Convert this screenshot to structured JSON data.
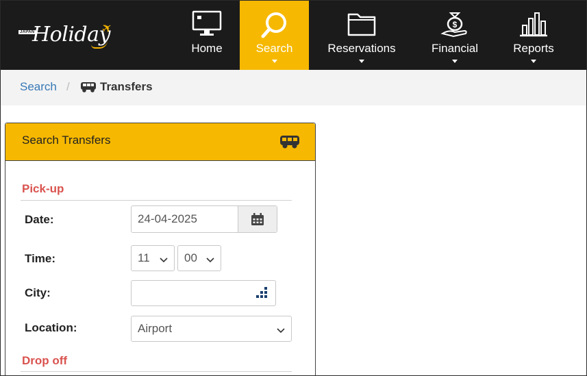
{
  "header": {
    "logo_text": "Holiday",
    "logo_tag": "JAPAN",
    "nav": [
      {
        "label": "Home",
        "icon": "monitor-icon"
      },
      {
        "label": "Search",
        "icon": "search-icon",
        "active": true
      },
      {
        "label": "Reservations",
        "icon": "folder-icon"
      },
      {
        "label": "Financial",
        "icon": "money-hand-icon"
      },
      {
        "label": "Reports",
        "icon": "bar-chart-icon"
      }
    ],
    "accent_color": "#f6b800"
  },
  "breadcrumb": {
    "link": "Search",
    "separator": "/",
    "current": "Transfers"
  },
  "panel": {
    "title": "Search Transfers",
    "pickup": {
      "title": "Pick-up",
      "date_label": "Date:",
      "date_value": "24-04-2025",
      "time_label": "Time:",
      "hour_value": "11",
      "minute_value": "00",
      "city_label": "City:",
      "city_value": "",
      "location_label": "Location:",
      "location_value": "Airport"
    },
    "dropoff": {
      "title": "Drop off"
    }
  }
}
